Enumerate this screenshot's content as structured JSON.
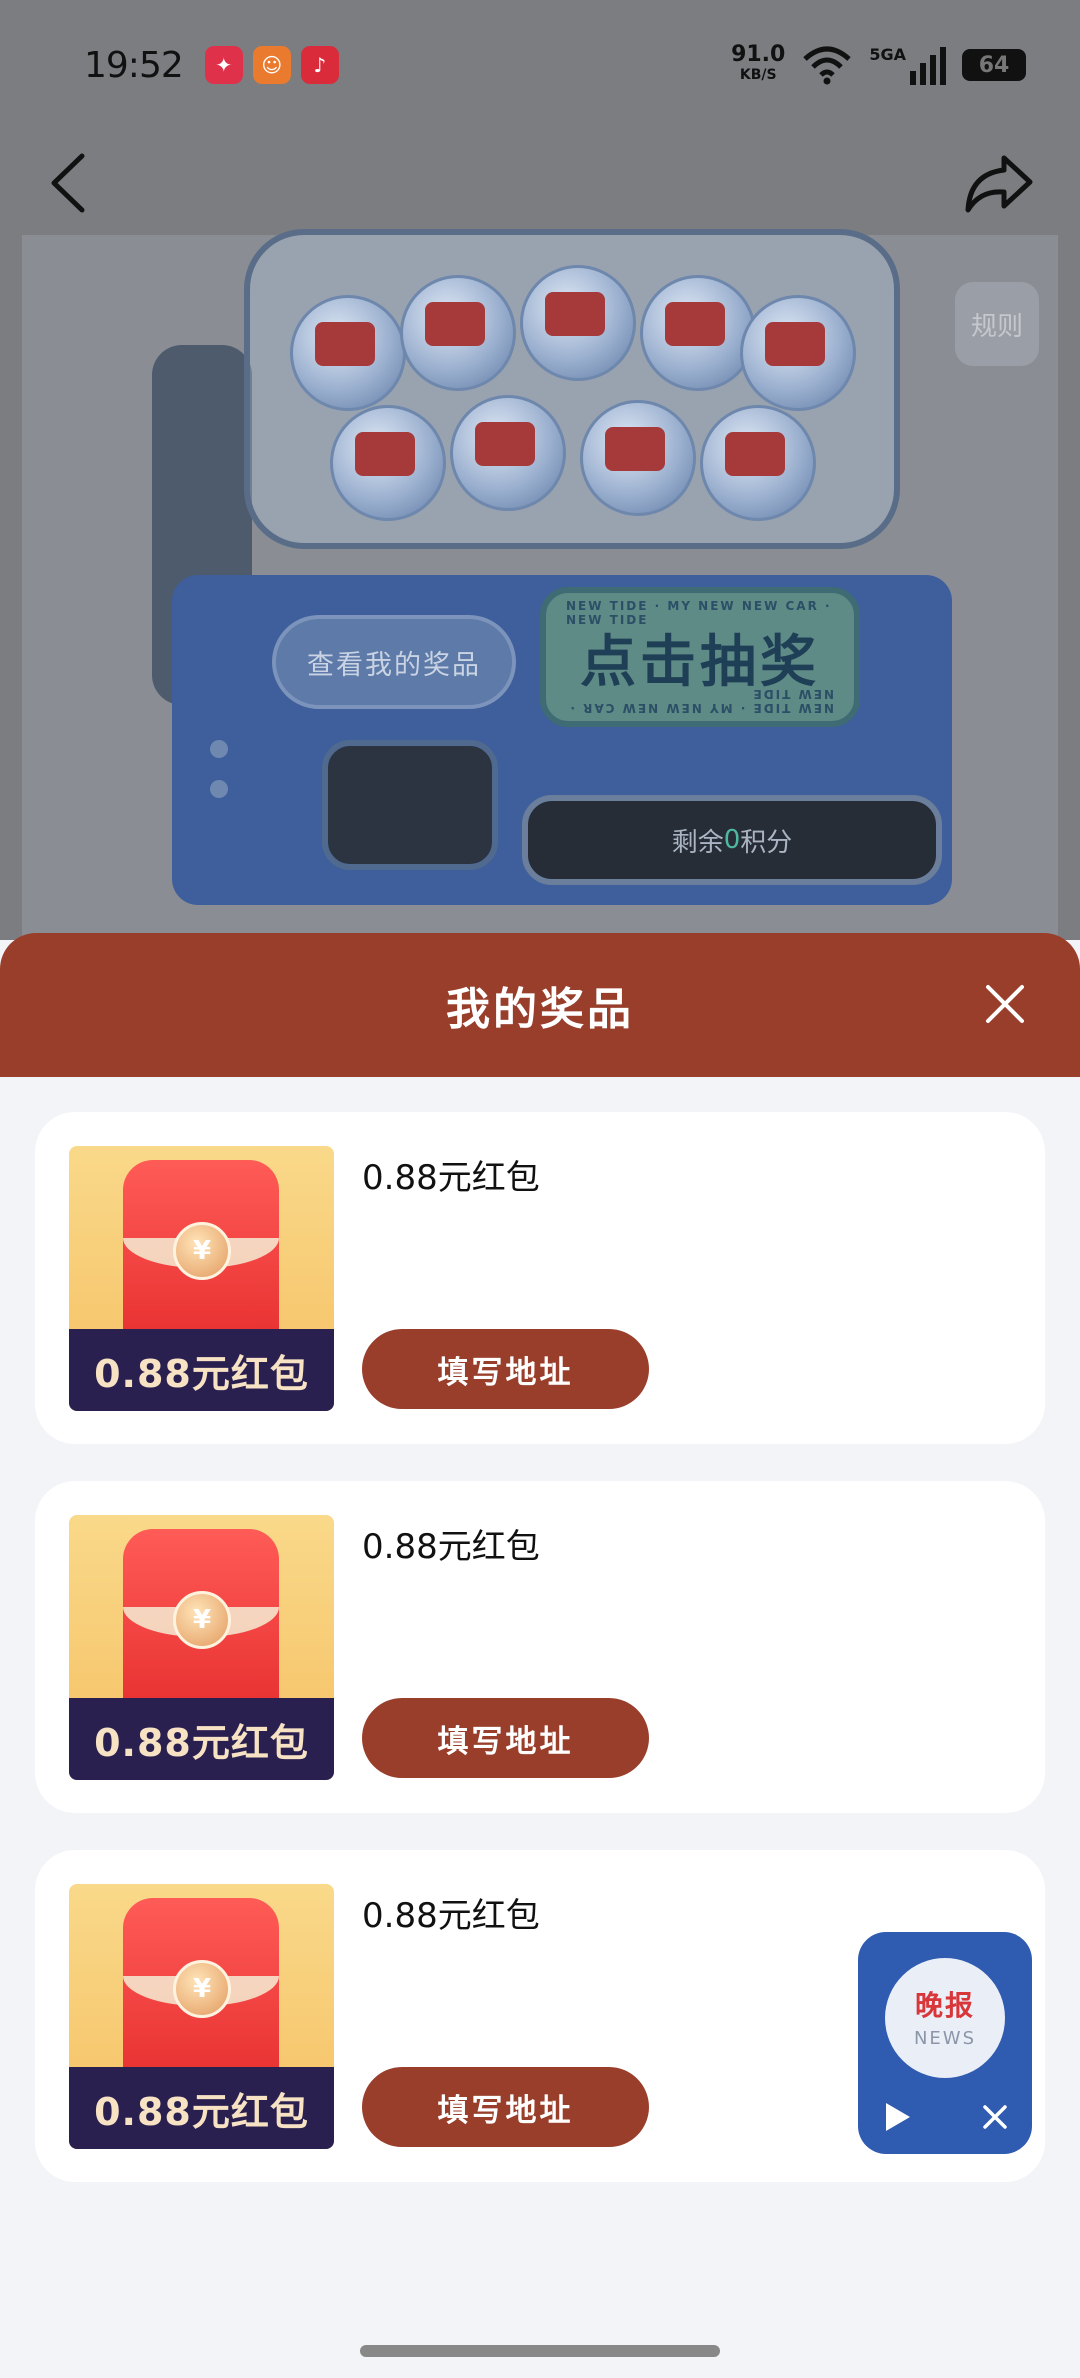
{
  "status_bar": {
    "time": "19:52",
    "net_speed": "91.0",
    "net_unit": "KB/S",
    "signal": "5GA",
    "battery": "64"
  },
  "banner": {
    "rules_label": "规则",
    "view_prizes_label": "查看我的奖品",
    "draw_label": "点击抽奖",
    "ring_text": "NEW TIDE · MY NEW NEW CAR · NEW TIDE",
    "points_prefix": "剩余",
    "points_value": "0",
    "points_suffix": "积分"
  },
  "sheet": {
    "title": "我的奖品",
    "prizes": [
      {
        "name": "0.88元红包",
        "thumb_label": "0.88元红包",
        "button": "填写地址"
      },
      {
        "name": "0.88元红包",
        "thumb_label": "0.88元红包",
        "button": "填写地址"
      },
      {
        "name": "0.88元红包",
        "thumb_label": "0.88元红包",
        "button": "填写地址"
      }
    ]
  },
  "float_widget": {
    "title": "晚报",
    "subtitle": "NEWS"
  },
  "colors": {
    "accent": "#983e2b",
    "float_bg": "#2f5bb0"
  }
}
